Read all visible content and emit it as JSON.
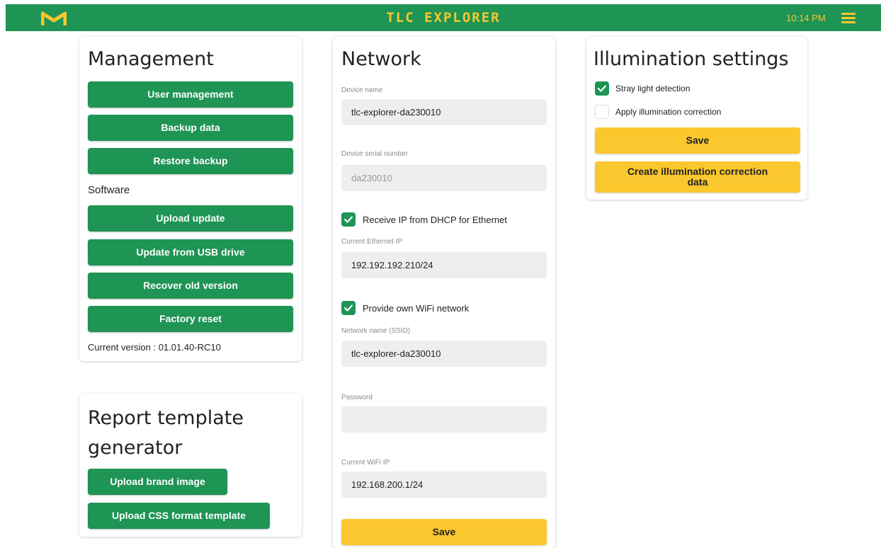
{
  "header": {
    "title": "TLC EXPLORER",
    "time": "10:14 PM",
    "brand_color": "#1e9455",
    "accent_color": "#f7c72d",
    "logo_icon": "m-logo-icon",
    "menu_icon": "hamburger-menu-icon"
  },
  "management": {
    "title": "Management",
    "user_management": "User management",
    "backup_data": "Backup data",
    "restore_backup": "Restore backup",
    "software_heading": "Software",
    "upload_update": "Upload update",
    "update_usb": "Update from USB drive",
    "recover_old": "Recover old version",
    "factory_reset": "Factory reset",
    "current_version": "Current version : 01.01.40-RC10"
  },
  "report": {
    "title": "Report template generator",
    "upload_brand": "Upload brand image",
    "upload_css": "Upload CSS format template"
  },
  "network": {
    "title": "Network",
    "device_name_label": "Device name",
    "device_name_value": "tlc-explorer-da230010",
    "serial_label": "Device serial number",
    "serial_value": "da230010",
    "dhcp_label": "Receive IP from DHCP for Ethernet",
    "dhcp_checked": true,
    "eth_ip_label": "Current Ethernet IP",
    "eth_ip_value": "192.192.192.210/24",
    "wifi_label": "Provide own WiFi network",
    "wifi_checked": true,
    "ssid_label": "Network name (SSID)",
    "ssid_value": "tlc-explorer-da230010",
    "password_label": "Password",
    "password_value": "",
    "wifi_ip_label": "Current WiFi IP",
    "wifi_ip_value": "192.168.200.1/24",
    "save": "Save"
  },
  "illumination": {
    "title": "Illumination settings",
    "stray_label": "Stray light detection",
    "stray_checked": true,
    "correction_label": "Apply illumination correction",
    "correction_checked": false,
    "save": "Save",
    "create_correction": "Create illumination correction data"
  }
}
